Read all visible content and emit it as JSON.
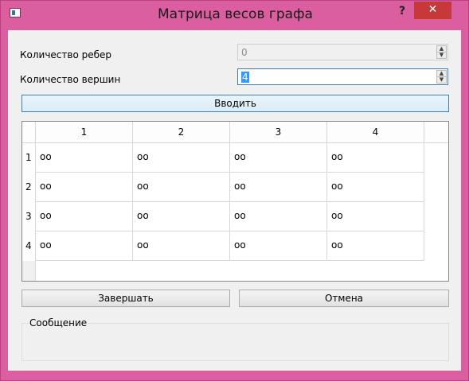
{
  "window": {
    "title": "Матрица весов графа",
    "help_glyph": "?",
    "close_glyph": "✕",
    "frame_color": "#db5ea0",
    "close_color": "#c7383a"
  },
  "form": {
    "edges_label": "Количество ребер",
    "edges_value": "0",
    "vertices_label": "Количество вершин",
    "vertices_value": "4",
    "enter_button": "Вводить"
  },
  "table": {
    "columns": [
      "1",
      "2",
      "3",
      "4"
    ],
    "rows": [
      {
        "header": "1",
        "cells": [
          "oo",
          "oo",
          "oo",
          "oo"
        ]
      },
      {
        "header": "2",
        "cells": [
          "oo",
          "oo",
          "oo",
          "oo"
        ]
      },
      {
        "header": "3",
        "cells": [
          "oo",
          "oo",
          "oo",
          "oo"
        ]
      },
      {
        "header": "4",
        "cells": [
          "oo",
          "oo",
          "oo",
          "oo"
        ]
      }
    ]
  },
  "actions": {
    "finish_button": "Завершать",
    "cancel_button": "Отмена"
  },
  "message": {
    "title": "Сообщение",
    "text": ""
  }
}
